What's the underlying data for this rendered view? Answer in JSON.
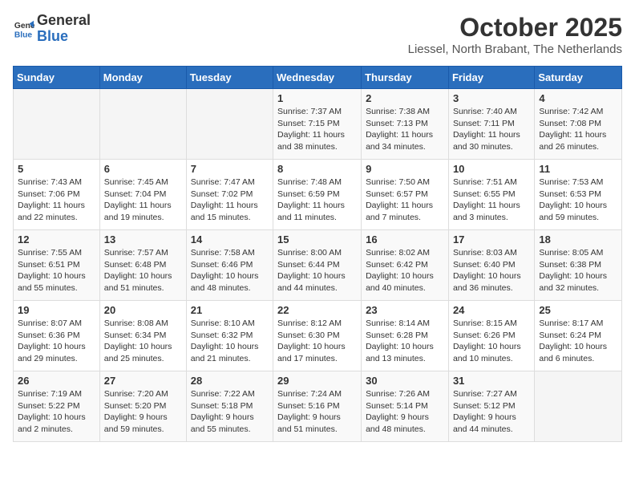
{
  "header": {
    "logo_line1": "General",
    "logo_line2": "Blue",
    "month_title": "October 2025",
    "location": "Liessel, North Brabant, The Netherlands"
  },
  "weekdays": [
    "Sunday",
    "Monday",
    "Tuesday",
    "Wednesday",
    "Thursday",
    "Friday",
    "Saturday"
  ],
  "weeks": [
    [
      {
        "day": "",
        "info": ""
      },
      {
        "day": "",
        "info": ""
      },
      {
        "day": "",
        "info": ""
      },
      {
        "day": "1",
        "info": "Sunrise: 7:37 AM\nSunset: 7:15 PM\nDaylight: 11 hours\nand 38 minutes."
      },
      {
        "day": "2",
        "info": "Sunrise: 7:38 AM\nSunset: 7:13 PM\nDaylight: 11 hours\nand 34 minutes."
      },
      {
        "day": "3",
        "info": "Sunrise: 7:40 AM\nSunset: 7:11 PM\nDaylight: 11 hours\nand 30 minutes."
      },
      {
        "day": "4",
        "info": "Sunrise: 7:42 AM\nSunset: 7:08 PM\nDaylight: 11 hours\nand 26 minutes."
      }
    ],
    [
      {
        "day": "5",
        "info": "Sunrise: 7:43 AM\nSunset: 7:06 PM\nDaylight: 11 hours\nand 22 minutes."
      },
      {
        "day": "6",
        "info": "Sunrise: 7:45 AM\nSunset: 7:04 PM\nDaylight: 11 hours\nand 19 minutes."
      },
      {
        "day": "7",
        "info": "Sunrise: 7:47 AM\nSunset: 7:02 PM\nDaylight: 11 hours\nand 15 minutes."
      },
      {
        "day": "8",
        "info": "Sunrise: 7:48 AM\nSunset: 6:59 PM\nDaylight: 11 hours\nand 11 minutes."
      },
      {
        "day": "9",
        "info": "Sunrise: 7:50 AM\nSunset: 6:57 PM\nDaylight: 11 hours\nand 7 minutes."
      },
      {
        "day": "10",
        "info": "Sunrise: 7:51 AM\nSunset: 6:55 PM\nDaylight: 11 hours\nand 3 minutes."
      },
      {
        "day": "11",
        "info": "Sunrise: 7:53 AM\nSunset: 6:53 PM\nDaylight: 10 hours\nand 59 minutes."
      }
    ],
    [
      {
        "day": "12",
        "info": "Sunrise: 7:55 AM\nSunset: 6:51 PM\nDaylight: 10 hours\nand 55 minutes."
      },
      {
        "day": "13",
        "info": "Sunrise: 7:57 AM\nSunset: 6:48 PM\nDaylight: 10 hours\nand 51 minutes."
      },
      {
        "day": "14",
        "info": "Sunrise: 7:58 AM\nSunset: 6:46 PM\nDaylight: 10 hours\nand 48 minutes."
      },
      {
        "day": "15",
        "info": "Sunrise: 8:00 AM\nSunset: 6:44 PM\nDaylight: 10 hours\nand 44 minutes."
      },
      {
        "day": "16",
        "info": "Sunrise: 8:02 AM\nSunset: 6:42 PM\nDaylight: 10 hours\nand 40 minutes."
      },
      {
        "day": "17",
        "info": "Sunrise: 8:03 AM\nSunset: 6:40 PM\nDaylight: 10 hours\nand 36 minutes."
      },
      {
        "day": "18",
        "info": "Sunrise: 8:05 AM\nSunset: 6:38 PM\nDaylight: 10 hours\nand 32 minutes."
      }
    ],
    [
      {
        "day": "19",
        "info": "Sunrise: 8:07 AM\nSunset: 6:36 PM\nDaylight: 10 hours\nand 29 minutes."
      },
      {
        "day": "20",
        "info": "Sunrise: 8:08 AM\nSunset: 6:34 PM\nDaylight: 10 hours\nand 25 minutes."
      },
      {
        "day": "21",
        "info": "Sunrise: 8:10 AM\nSunset: 6:32 PM\nDaylight: 10 hours\nand 21 minutes."
      },
      {
        "day": "22",
        "info": "Sunrise: 8:12 AM\nSunset: 6:30 PM\nDaylight: 10 hours\nand 17 minutes."
      },
      {
        "day": "23",
        "info": "Sunrise: 8:14 AM\nSunset: 6:28 PM\nDaylight: 10 hours\nand 13 minutes."
      },
      {
        "day": "24",
        "info": "Sunrise: 8:15 AM\nSunset: 6:26 PM\nDaylight: 10 hours\nand 10 minutes."
      },
      {
        "day": "25",
        "info": "Sunrise: 8:17 AM\nSunset: 6:24 PM\nDaylight: 10 hours\nand 6 minutes."
      }
    ],
    [
      {
        "day": "26",
        "info": "Sunrise: 7:19 AM\nSunset: 5:22 PM\nDaylight: 10 hours\nand 2 minutes."
      },
      {
        "day": "27",
        "info": "Sunrise: 7:20 AM\nSunset: 5:20 PM\nDaylight: 9 hours\nand 59 minutes."
      },
      {
        "day": "28",
        "info": "Sunrise: 7:22 AM\nSunset: 5:18 PM\nDaylight: 9 hours\nand 55 minutes."
      },
      {
        "day": "29",
        "info": "Sunrise: 7:24 AM\nSunset: 5:16 PM\nDaylight: 9 hours\nand 51 minutes."
      },
      {
        "day": "30",
        "info": "Sunrise: 7:26 AM\nSunset: 5:14 PM\nDaylight: 9 hours\nand 48 minutes."
      },
      {
        "day": "31",
        "info": "Sunrise: 7:27 AM\nSunset: 5:12 PM\nDaylight: 9 hours\nand 44 minutes."
      },
      {
        "day": "",
        "info": ""
      }
    ]
  ]
}
